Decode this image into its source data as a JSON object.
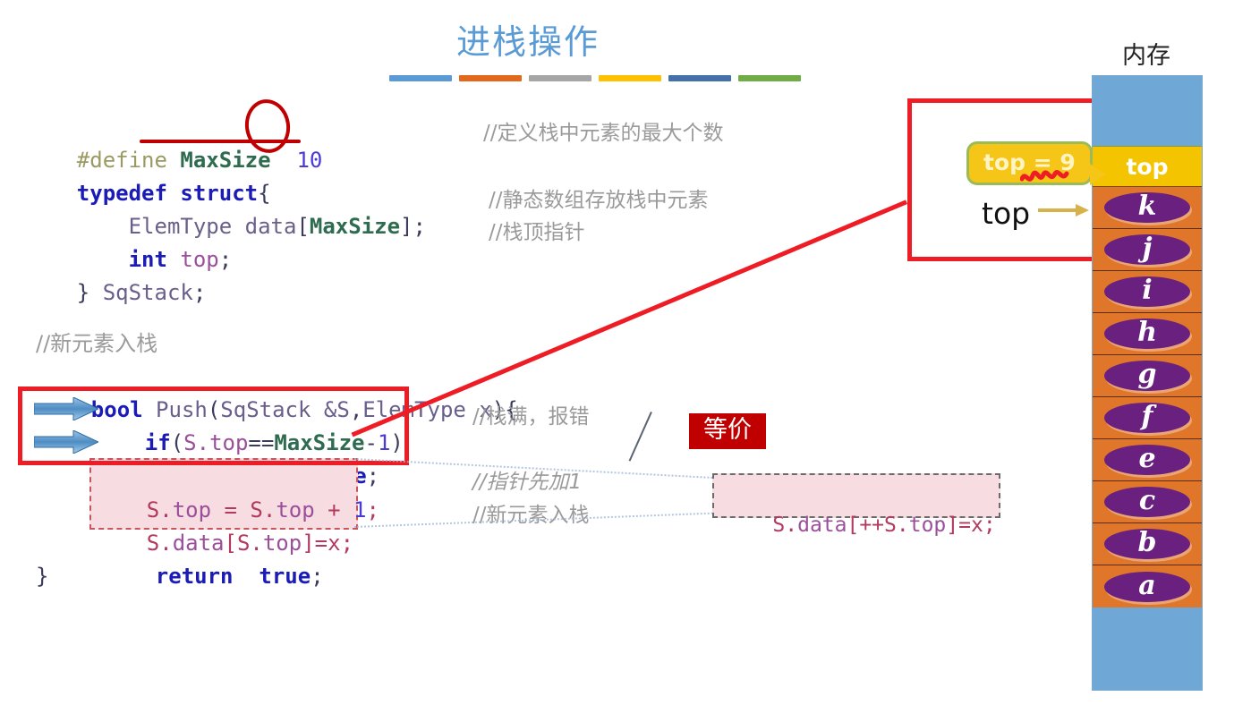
{
  "slide": {
    "title": "进栈操作",
    "accent_color": "#5B9BD5",
    "colorbar": [
      "#5B9BD5",
      "#E2681C",
      "#A6A6A6",
      "#FFC000",
      "#4472A8",
      "#70AD47"
    ]
  },
  "code": {
    "lines": [
      {
        "text": "#define MaxSize 10",
        "comment": "//定义栈中元素的最大个数"
      },
      {
        "text": "typedef struct{",
        "comment": ""
      },
      {
        "text": "    ElemType data[MaxSize];",
        "comment": "//静态数组存放栈中元素"
      },
      {
        "text": "    int top;",
        "comment": "//栈顶指针"
      },
      {
        "text": "} SqStack;",
        "comment": ""
      },
      {
        "text": " //新元素入栈",
        "comment": ""
      },
      {
        "text": " bool Push(SqStack &S,ElemType x){",
        "comment": ""
      },
      {
        "text": "   if(S.top==MaxSize-1)",
        "comment": "//栈满，报错"
      },
      {
        "text": "       return  false;",
        "comment": ""
      },
      {
        "text": "   S.top = S.top + 1;",
        "comment": "//指针先加1"
      },
      {
        "text": "   S.data[S.top]=x;",
        "comment": "//新元素入栈"
      },
      {
        "text": "    return  true;",
        "comment": ""
      },
      {
        "text": " }",
        "comment": ""
      }
    ],
    "tokens": {
      "define_directive": "#define",
      "macro_name": "MaxSize",
      "macro_value": "10",
      "typedef": "typedef",
      "struct": "struct",
      "elem_type": "ElemType",
      "data": "data",
      "int": "int",
      "top": "top",
      "sqstack": "SqStack",
      "comment_new_push": "//新元素入栈",
      "bool": "bool",
      "push": "Push",
      "param_s": "&S",
      "param_x": "x",
      "if": "if",
      "cond": "S.top==MaxSize-1",
      "return": "return",
      "false": "false",
      "true": "true",
      "inc_line": "S.top = S.top + 1;",
      "assign_line": "S.data[S.top]=x;"
    },
    "comments": {
      "max_count": "//定义栈中元素的最大个数",
      "static_array": "//静态数组存放栈中元素",
      "top_pointer": "//栈顶指针",
      "stack_full": "//栈满，报错",
      "pointer_first_add_one": "//指针先加1",
      "new_elem_push": "//新元素入栈"
    }
  },
  "equiv": {
    "label": "等价",
    "label_bg": "#C00000",
    "snippet": "S.data[++S.top]=x;"
  },
  "memory": {
    "label": "内存",
    "top_cell_label": "top",
    "items": [
      "k",
      "j",
      "i",
      "h",
      "g",
      "f",
      "e",
      "c",
      "b",
      "a"
    ],
    "colors": {
      "free": "#6FA8D6",
      "top": "#F5C400",
      "used": "#E0762A",
      "ellipse": "#69207F"
    }
  },
  "callout": {
    "text": "top = 9",
    "bg": "#F5C518",
    "border": "#9BBB59",
    "pointer_word": "top"
  },
  "annotations": {
    "highlight_color": "#EE1C25",
    "circle_color": "#C00000",
    "pink_bg": "#F7DDE1"
  }
}
